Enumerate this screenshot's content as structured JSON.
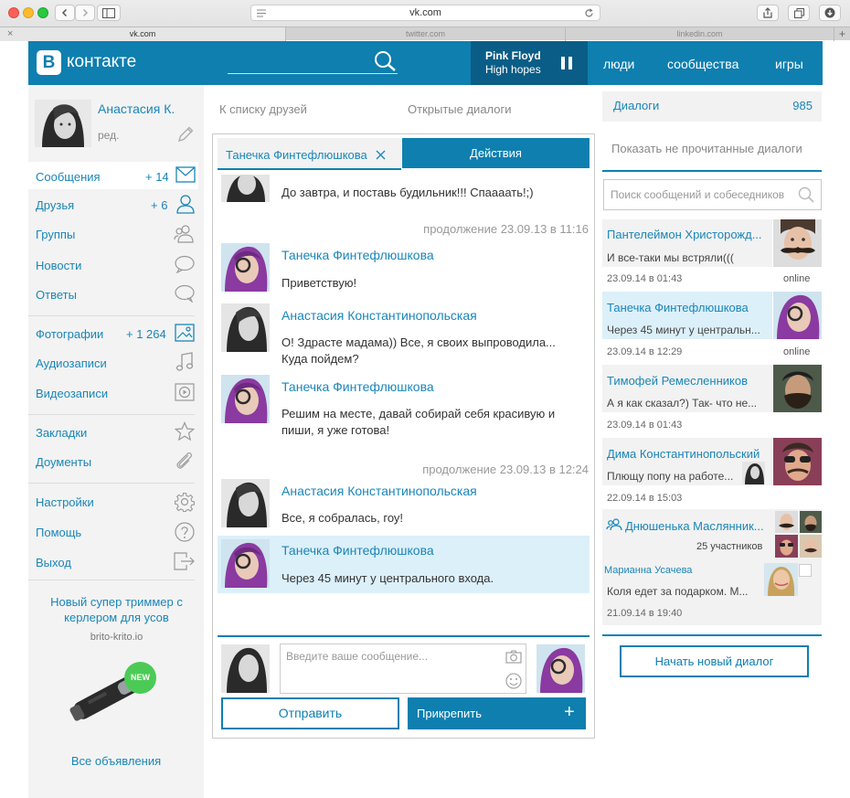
{
  "browser": {
    "url": "vk.com",
    "tabs": [
      "vk.com",
      "twitter.com",
      "linkedin.com"
    ],
    "tab_add": "+",
    "tab_close": "×"
  },
  "header": {
    "logo_letter": "В",
    "logo_text": "контакте",
    "search_placeholder": "",
    "player_artist": "Pink Floyd",
    "player_track": "High hopes",
    "nav": [
      "люди",
      "сообщества",
      "игры"
    ]
  },
  "profile": {
    "name": "Анастасия К.",
    "edit": "ред."
  },
  "menu": [
    {
      "label": "Сообщения",
      "count": "+ 14",
      "icon": "envelope-icon"
    },
    {
      "label": "Друзья",
      "count": "+ 6",
      "icon": "person-icon"
    },
    {
      "label": "Группы",
      "count": "",
      "icon": "group-icon"
    },
    {
      "label": "Новости",
      "count": "",
      "icon": "speech-bubble-icon"
    },
    {
      "label": "Ответы",
      "count": "",
      "icon": "chat-bubbles-icon"
    },
    {
      "label": "Фотографии",
      "count": "+ 1 264",
      "icon": "photo-icon"
    },
    {
      "label": "Аудиозаписи",
      "count": "",
      "icon": "music-note-icon"
    },
    {
      "label": "Видеозаписи",
      "count": "",
      "icon": "video-play-icon"
    },
    {
      "label": "Закладки",
      "count": "",
      "icon": "star-icon"
    },
    {
      "label": "Доументы",
      "count": "",
      "icon": "paperclip-icon"
    },
    {
      "label": "Настройки",
      "count": "",
      "icon": "gear-icon"
    },
    {
      "label": "Помощь",
      "count": "",
      "icon": "question-icon"
    },
    {
      "label": "Выход",
      "count": "",
      "icon": "exit-icon"
    }
  ],
  "ad": {
    "title": "Новый супер триммер с керлером для усов",
    "site": "brito-krito.io",
    "badge": "NEW",
    "all_ads": "Все объявления"
  },
  "center": {
    "back_link": "К списку друзей",
    "open_dialogs": "Открытые диалоги",
    "tab_name": "Танечка Финтефлюшкова",
    "actions": "Действия",
    "messages": [
      {
        "text": "До завтра, и поставь будильник!!! Спаааать!;)"
      },
      {
        "timestamp": "продолжение 23.09.13 в 11:16"
      },
      {
        "name": "Танечка Финтефлюшкова",
        "text": "Приветствую!"
      },
      {
        "name": "Анастасия Константинопольская",
        "text": "О! Здрасте мадама)) Все, я своих выпроводила... Куда пойдем?"
      },
      {
        "name": "Танечка Финтефлюшкова",
        "text": "Решим на месте, давай собирай себя красивую и пиши, я уже готова!"
      },
      {
        "timestamp": "продолжение 23.09.13 в 12:24"
      },
      {
        "name": "Анастасия Константинопольская",
        "text": "Все, я собралась, гоу!"
      },
      {
        "name": "Танечка Финтефлюшкова",
        "text": "Через 45 минут у центрального входа."
      }
    ],
    "input_placeholder": "Введите ваше сообщение...",
    "send": "Отправить",
    "attach": "Прикрепить",
    "attach_plus": "+"
  },
  "right": {
    "dialogs_label": "Диалоги",
    "dialogs_count": "985",
    "show_unread": "Показать не прочитанные диалоги",
    "search_placeholder": "Поиск сообщений и собеседников",
    "dialogs": [
      {
        "name": "Пантелеймон Христорожд...",
        "text": "И все-таки мы встряли(((",
        "date": "23.09.14 в 01:43",
        "status": "online"
      },
      {
        "name": "Танечка Финтефлюшкова",
        "text": "Через 45 минут у центральн...",
        "date": "23.09.14 в 12:29",
        "status": "online"
      },
      {
        "name": "Тимофей Ремесленников",
        "text": "А я как сказал?) Так- что не...",
        "date": "23.09.14 в 01:43",
        "status": ""
      },
      {
        "name": "Дима Константинопольский",
        "text": "Плющу попу на работе...",
        "date": "22.09.14 в 15:03",
        "status": ""
      },
      {
        "name": "Днюшенька Маслянник...",
        "participants": "25 участников",
        "sender": "Марианна Усачева",
        "text": "Коля едет за подарком. М...",
        "date": "21.09.14 в 19:40"
      }
    ],
    "new_dialog": "Начать новый диалог"
  }
}
